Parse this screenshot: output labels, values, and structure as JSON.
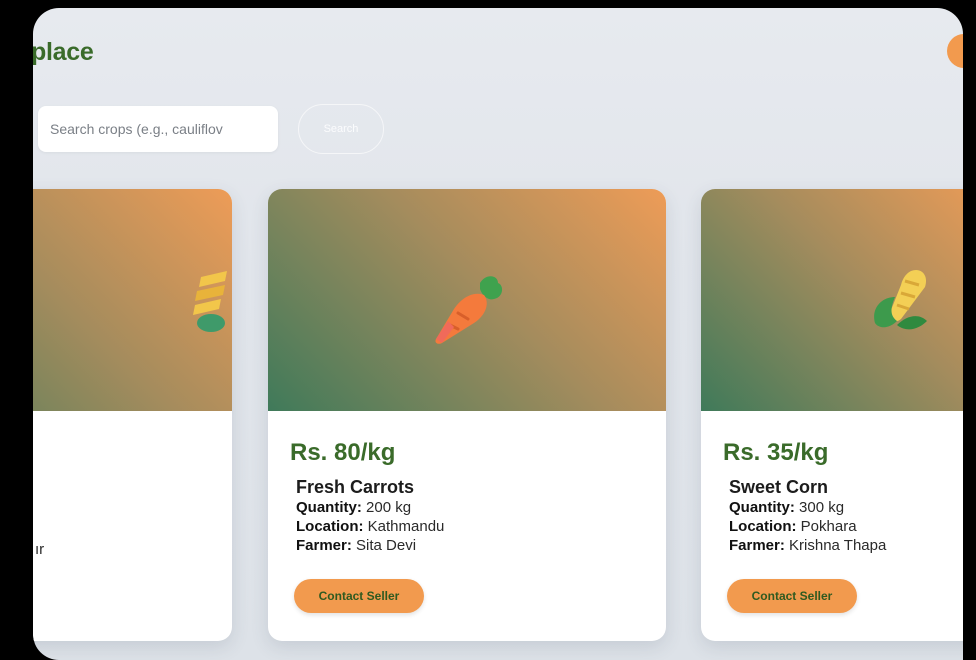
{
  "header": {
    "title": "place"
  },
  "search": {
    "placeholder": "Search crops (e.g., cauliflov",
    "button_label": "Search"
  },
  "cards": [
    {
      "price": "",
      "name": "",
      "detail_tail": "ır",
      "icon": "wheat-icon"
    },
    {
      "price": "Rs. 80/kg",
      "name": "Fresh Carrots",
      "quantity_label": "Quantity:",
      "quantity": " 200 kg",
      "location_label": "Location:",
      "location": " Kathmandu",
      "farmer_label": "Farmer:",
      "farmer": " Sita Devi",
      "contact_label": "Contact Seller",
      "icon": "carrot-icon"
    },
    {
      "price": "Rs. 35/kg",
      "name": "Sweet Corn",
      "quantity_label": "Quantity:",
      "quantity": " 300 kg",
      "location_label": "Location:",
      "location": " Pokhara",
      "farmer_label": "Farmer:",
      "farmer": " Krishna Thapa",
      "contact_label": "Contact Seller",
      "icon": "corn-icon"
    }
  ],
  "colors": {
    "accent": "#f29a4e",
    "primary": "#3a6b2a"
  }
}
